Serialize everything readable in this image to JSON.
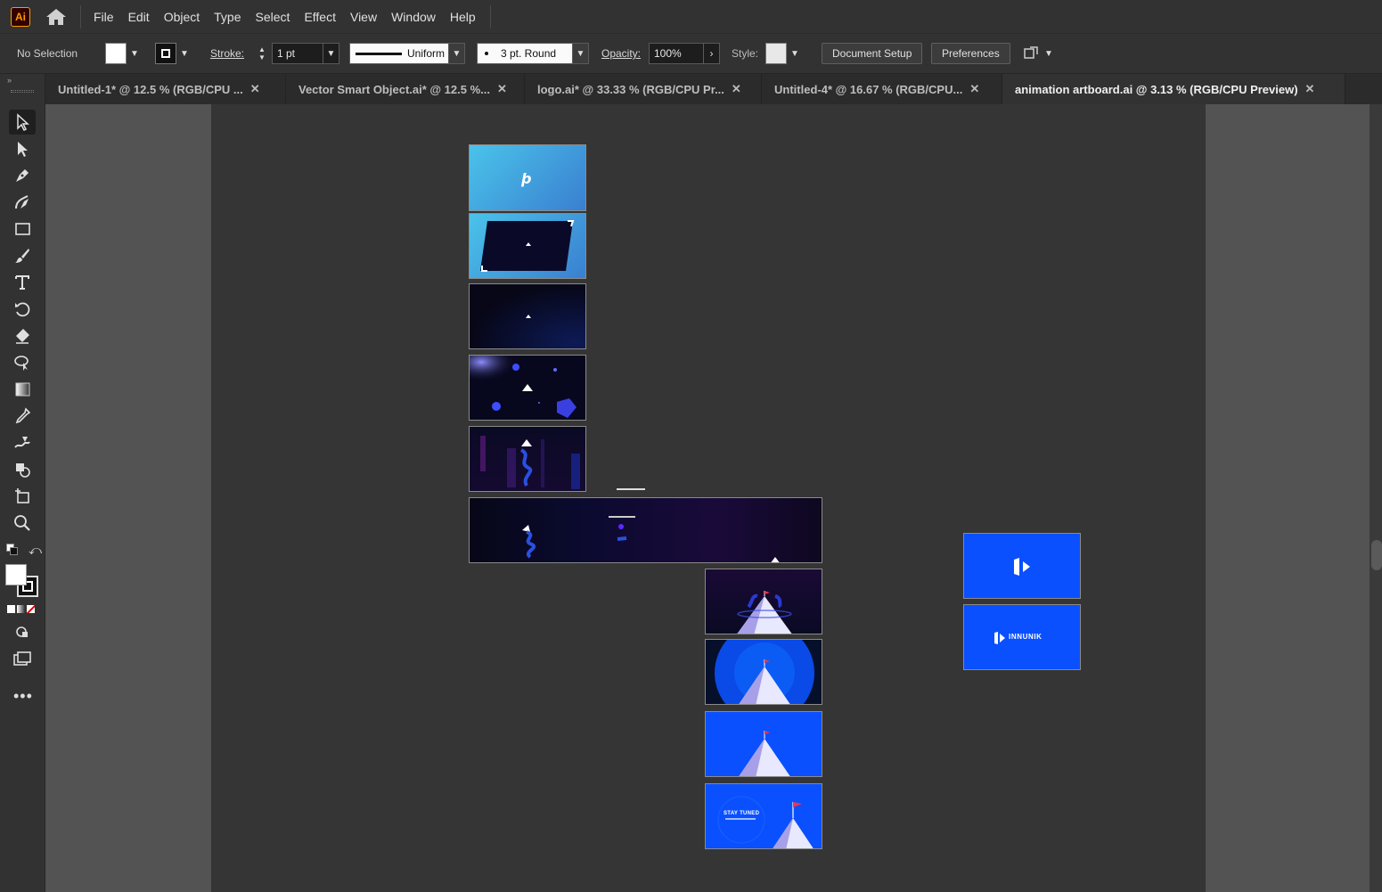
{
  "app": {
    "logo": "Ai",
    "home": "home-icon"
  },
  "menu": [
    "File",
    "Edit",
    "Object",
    "Type",
    "Select",
    "Effect",
    "View",
    "Window",
    "Help"
  ],
  "control": {
    "selection": "No Selection",
    "stroke_label": "Stroke:",
    "stroke_value": "1 pt",
    "profile": "Uniform",
    "brush": "3 pt. Round",
    "opacity_label": "Opacity:",
    "opacity_value": "100%",
    "style_label": "Style:",
    "document_setup": "Document Setup",
    "preferences": "Preferences"
  },
  "tabs": [
    {
      "label": "Untitled-1* @ 12.5 % (RGB/CPU ...",
      "active": false
    },
    {
      "label": "Vector Smart Object.ai* @ 12.5 %...",
      "active": false
    },
    {
      "label": "logo.ai* @ 33.33 % (RGB/CPU Pr...",
      "active": false
    },
    {
      "label": "Untitled-4* @ 16.67 % (RGB/CPU...",
      "active": false
    },
    {
      "label": "animation artboard.ai @ 3.13 % (RGB/CPU Preview)",
      "active": true
    }
  ],
  "tools": [
    "selection-tool",
    "direct-selection-tool",
    "pen-tool",
    "curvature-tool",
    "rectangle-tool",
    "paintbrush-tool",
    "type-tool",
    "rotate-tool",
    "eraser-tool",
    "lasso-tool",
    "gradient-tool",
    "eyedropper-tool",
    "blend-tool",
    "shape-builder-tool",
    "artboard-tool",
    "zoom-tool"
  ],
  "artboards": {
    "brand_name": "INNUNIK",
    "stay_tuned": "STAY TUNED"
  },
  "colors": {
    "accent_blue": "#0a50ff",
    "dark_navy": "#0a0a2a",
    "sky": "#4ab8e6"
  }
}
